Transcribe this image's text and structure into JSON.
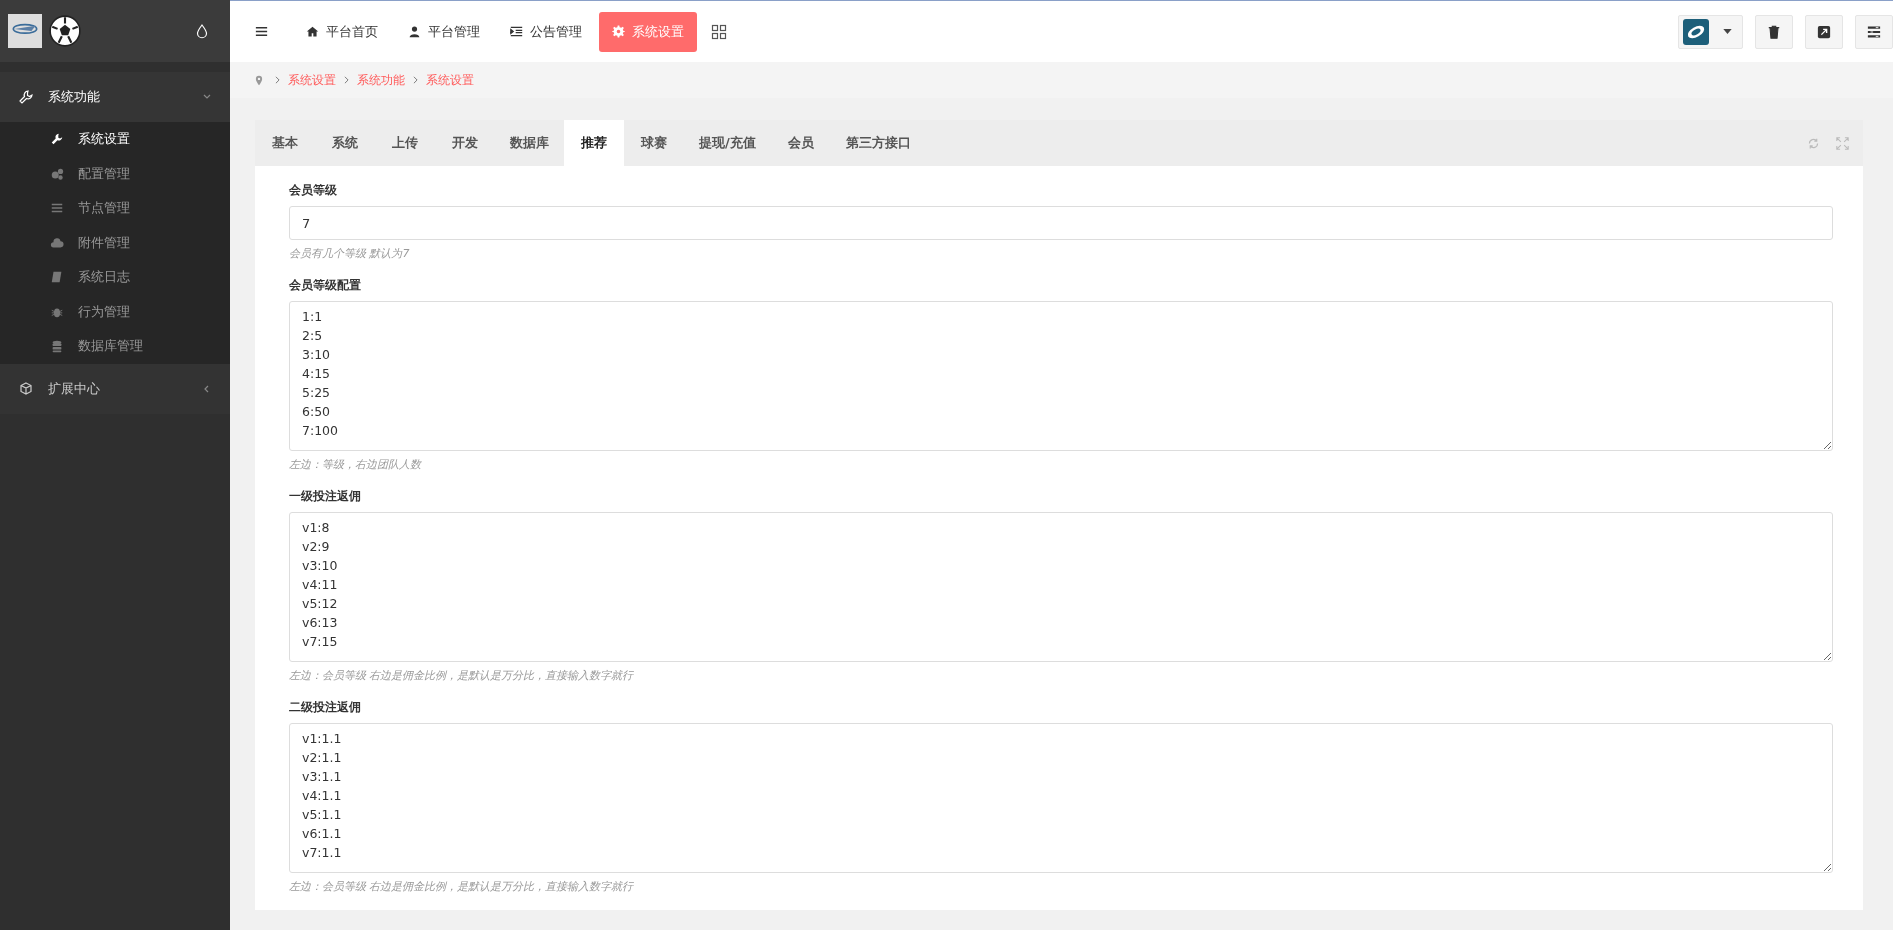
{
  "sidebar": {
    "groups": [
      {
        "label": "系统功能",
        "expanded": true,
        "children": [
          {
            "label": "系统设置",
            "selected": true
          },
          {
            "label": "配置管理",
            "selected": false
          },
          {
            "label": "节点管理",
            "selected": false
          },
          {
            "label": "附件管理",
            "selected": false
          },
          {
            "label": "系统日志",
            "selected": false
          },
          {
            "label": "行为管理",
            "selected": false
          },
          {
            "label": "数据库管理",
            "selected": false
          }
        ]
      },
      {
        "label": "扩展中心",
        "expanded": false
      }
    ]
  },
  "topnav": {
    "items": [
      {
        "label": "平台首页",
        "selected": false
      },
      {
        "label": "平台管理",
        "selected": false
      },
      {
        "label": "公告管理",
        "selected": false
      },
      {
        "label": "系统设置",
        "selected": true
      }
    ]
  },
  "breadcrumb": [
    "系统设置",
    "系统功能",
    "系统设置"
  ],
  "tabs": [
    {
      "label": "基本",
      "selected": false
    },
    {
      "label": "系统",
      "selected": false
    },
    {
      "label": "上传",
      "selected": false
    },
    {
      "label": "开发",
      "selected": false
    },
    {
      "label": "数据库",
      "selected": false
    },
    {
      "label": "推荐",
      "selected": true
    },
    {
      "label": "球赛",
      "selected": false
    },
    {
      "label": "提现/充值",
      "selected": false
    },
    {
      "label": "会员",
      "selected": false
    },
    {
      "label": "第三方接口",
      "selected": false
    }
  ],
  "fields": [
    {
      "kind": "input",
      "label": "会员等级",
      "value": "7",
      "hint": "会员有几个等级 默认为7"
    },
    {
      "kind": "textarea",
      "label": "会员等级配置",
      "value": "1:1\n2:5\n3:10\n4:15\n5:25\n6:50\n7:100",
      "hint": "左边：等级，右边团队人数"
    },
    {
      "kind": "textarea",
      "label": "一级投注返佣",
      "value": "v1:8\nv2:9\nv3:10\nv4:11\nv5:12\nv6:13\nv7:15",
      "hint": "左边：会员等级 右边是佣金比例，是默认是万分比，直接输入数字就行"
    },
    {
      "kind": "textarea",
      "label": "二级投注返佣",
      "value": "v1:1.1\nv2:1.1\nv3:1.1\nv4:1.1\nv5:1.1\nv6:1.1\nv7:1.1",
      "hint": "左边：会员等级 右边是佣金比例，是默认是万分比，直接输入数字就行"
    }
  ]
}
